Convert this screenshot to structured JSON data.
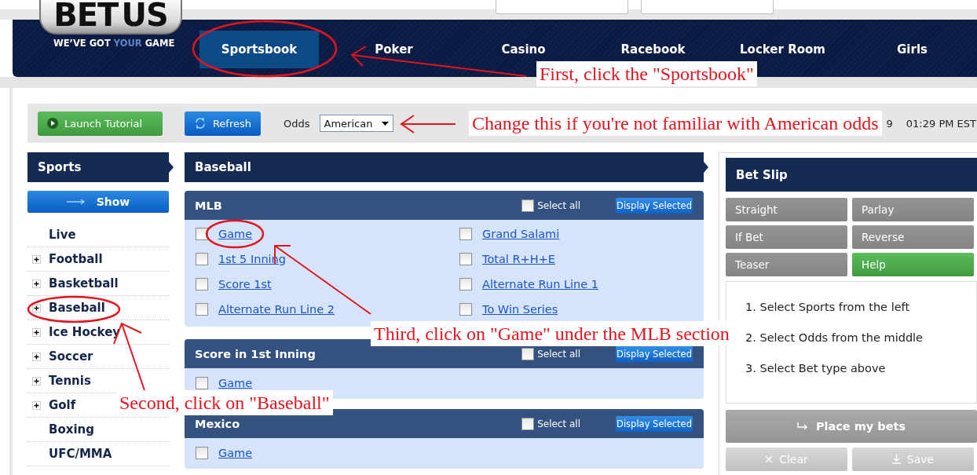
{
  "header": {
    "logo": {
      "left": "BET",
      "right": "US",
      "tagline_start": "WE’VE GOT ",
      "tagline_highlight": "YOUR",
      "tagline_end": " GAME"
    },
    "nav": [
      {
        "label": "Sportsbook",
        "selected": true
      },
      {
        "label": "Poker",
        "selected": false
      },
      {
        "label": "Casino",
        "selected": false
      },
      {
        "label": "Racebook",
        "selected": false
      },
      {
        "label": "Locker Room",
        "selected": false
      },
      {
        "label": "Girls",
        "selected": false
      }
    ]
  },
  "toolbar": {
    "tutorial_button": "Launch Tutorial",
    "refresh_button": "Refresh",
    "odds_label": "Odds",
    "odds_select": {
      "value": "American"
    },
    "date_fragment": "9",
    "time": "01:29 PM EST"
  },
  "sidebar": {
    "title": "Sports",
    "show_button": "Show",
    "items": [
      {
        "label": "Live",
        "expandable": false
      },
      {
        "label": "Football",
        "expandable": true
      },
      {
        "label": "Basketball",
        "expandable": true
      },
      {
        "label": "Baseball",
        "expandable": true
      },
      {
        "label": "Ice Hockey",
        "expandable": true
      },
      {
        "label": "Soccer",
        "expandable": true
      },
      {
        "label": "Tennis",
        "expandable": true
      },
      {
        "label": "Golf",
        "expandable": true
      },
      {
        "label": "Boxing",
        "expandable": false
      },
      {
        "label": "UFC/MMA",
        "expandable": false
      }
    ]
  },
  "main": {
    "title": "Baseball",
    "sections": [
      {
        "title": "MLB",
        "select_all": {
          "label": "Select all",
          "checked": false
        },
        "display_button": "Display Selected",
        "links": [
          {
            "label": "Game",
            "checked": false
          },
          {
            "label": "Grand Salami",
            "checked": false
          },
          {
            "label": "1st 5 Inning",
            "checked": false
          },
          {
            "label": "Total R+H+E",
            "checked": false
          },
          {
            "label": "Score 1st",
            "checked": false
          },
          {
            "label": "Alternate Run Line 1",
            "checked": false
          },
          {
            "label": "Alternate Run Line 2",
            "checked": false
          },
          {
            "label": "To Win Series",
            "checked": false
          }
        ]
      },
      {
        "title": "Score in 1st Inning",
        "select_all": {
          "label": "Select all",
          "checked": false
        },
        "display_button": "Display Selected",
        "links": [
          {
            "label": "Game",
            "checked": false
          }
        ]
      },
      {
        "title": "Mexico",
        "select_all": {
          "label": "Select all",
          "checked": false
        },
        "display_button": "Display Selected",
        "links": [
          {
            "label": "Game",
            "checked": false
          }
        ]
      }
    ]
  },
  "bet_slip": {
    "title": "Bet Slip",
    "bet_types": [
      {
        "label": "Straight",
        "selected": false
      },
      {
        "label": "Parlay",
        "selected": false
      },
      {
        "label": "If Bet",
        "selected": false
      },
      {
        "label": "Reverse",
        "selected": false
      },
      {
        "label": "Teaser",
        "selected": false
      },
      {
        "label": "Help",
        "selected": true
      }
    ],
    "instructions": [
      "1. Select Sports from the left",
      "2. Select Odds from the middle",
      "3. Select Bet type above"
    ],
    "place_button": "Place my bets",
    "clear_button": "Clear",
    "save_button": "Save"
  },
  "annotations": [
    {
      "text": "First, click the \"Sportsbook\""
    },
    {
      "text": "Change this if you're not familiar with American odds"
    },
    {
      "text": "Third, click on \"Game\" under the MLB section"
    },
    {
      "text": "Second, click on \"Baseball\""
    }
  ]
}
